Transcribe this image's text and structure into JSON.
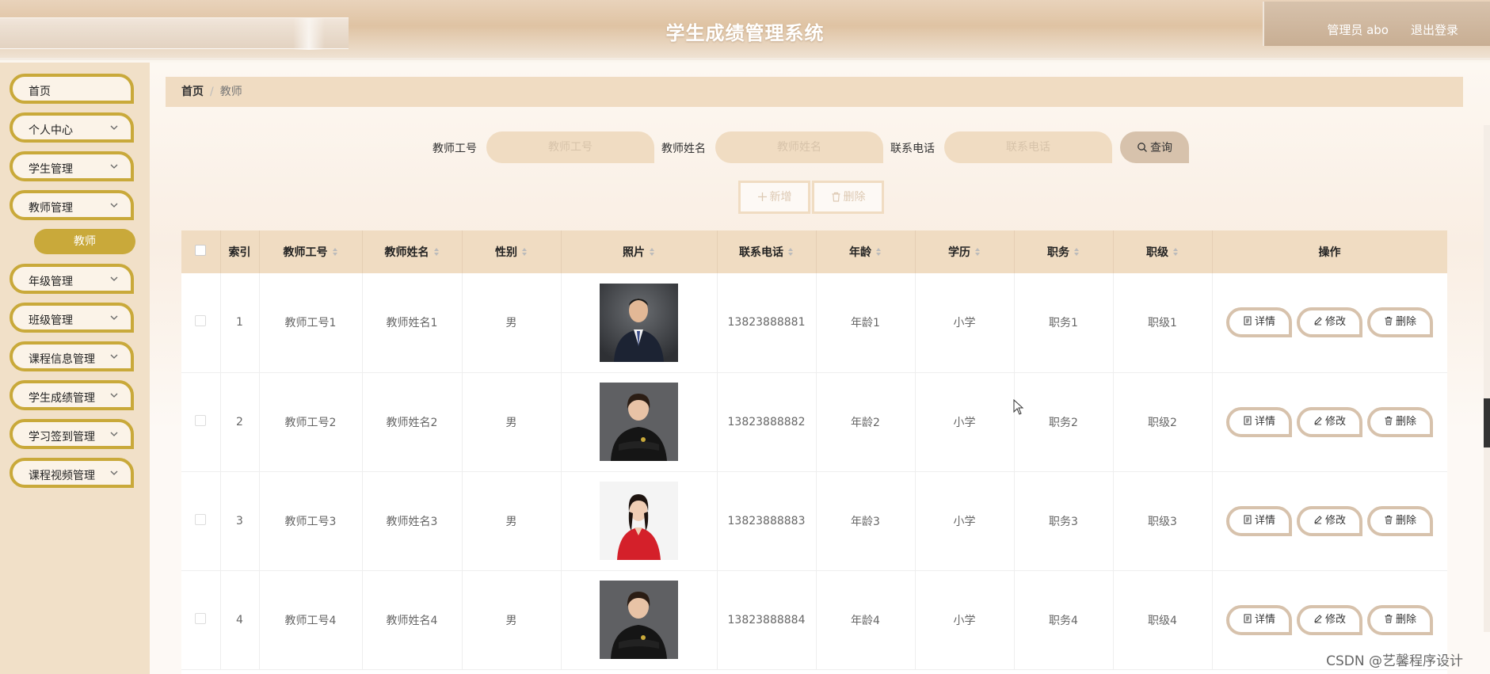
{
  "header": {
    "title": "学生成绩管理系统",
    "user_label": "管理员 abo",
    "logout_label": "退出登录"
  },
  "sidebar": {
    "items": [
      {
        "label": "首页",
        "has_arrow": false
      },
      {
        "label": "个人中心",
        "has_arrow": true
      },
      {
        "label": "学生管理",
        "has_arrow": true
      },
      {
        "label": "教师管理",
        "has_arrow": true
      },
      {
        "label": "年级管理",
        "has_arrow": true
      },
      {
        "label": "班级管理",
        "has_arrow": true
      },
      {
        "label": "课程信息管理",
        "has_arrow": true
      },
      {
        "label": "学生成绩管理",
        "has_arrow": true
      },
      {
        "label": "学习签到管理",
        "has_arrow": true
      },
      {
        "label": "课程视频管理",
        "has_arrow": true
      }
    ],
    "active_sub": "教师"
  },
  "breadcrumb": {
    "home": "首页",
    "separator": "/",
    "current": "教师"
  },
  "search": {
    "fields": [
      {
        "label": "教师工号",
        "placeholder": "教师工号",
        "value": ""
      },
      {
        "label": "教师姓名",
        "placeholder": "教师姓名",
        "value": ""
      },
      {
        "label": "联系电话",
        "placeholder": "联系电话",
        "value": ""
      }
    ],
    "query_label": "查询"
  },
  "actions": {
    "add_label": "新增",
    "delete_label": "删除"
  },
  "table": {
    "columns": [
      "索引",
      "教师工号",
      "教师姓名",
      "性别",
      "照片",
      "联系电话",
      "年龄",
      "学历",
      "职务",
      "职级",
      "操作"
    ],
    "rows": [
      {
        "index": "1",
        "id": "教师工号1",
        "name": "教师姓名1",
        "gender": "男",
        "photo": "man-dark-suit",
        "phone": "13823888881",
        "age": "年龄1",
        "edu": "小学",
        "duty": "职务1",
        "rank": "职级1"
      },
      {
        "index": "2",
        "id": "教师工号2",
        "name": "教师姓名2",
        "gender": "男",
        "photo": "woman-black-suit",
        "phone": "13823888882",
        "age": "年龄2",
        "edu": "小学",
        "duty": "职务2",
        "rank": "职级2"
      },
      {
        "index": "3",
        "id": "教师工号3",
        "name": "教师姓名3",
        "gender": "男",
        "photo": "woman-red-dress",
        "phone": "13823888883",
        "age": "年龄3",
        "edu": "小学",
        "duty": "职务3",
        "rank": "职级3"
      },
      {
        "index": "4",
        "id": "教师工号4",
        "name": "教师姓名4",
        "gender": "男",
        "photo": "woman-black-suit",
        "phone": "13823888884",
        "age": "年龄4",
        "edu": "小学",
        "duty": "职务4",
        "rank": "职级4"
      }
    ],
    "row_actions": {
      "detail": "详情",
      "edit": "修改",
      "delete": "删除"
    }
  },
  "watermark": "CSDN @艺馨程序设计",
  "colors": {
    "accent": "#c9a93a",
    "header_band": "#f0dcc2",
    "sidebar_bg": "#f1e0c8",
    "button_border": "#d7c2ac"
  }
}
